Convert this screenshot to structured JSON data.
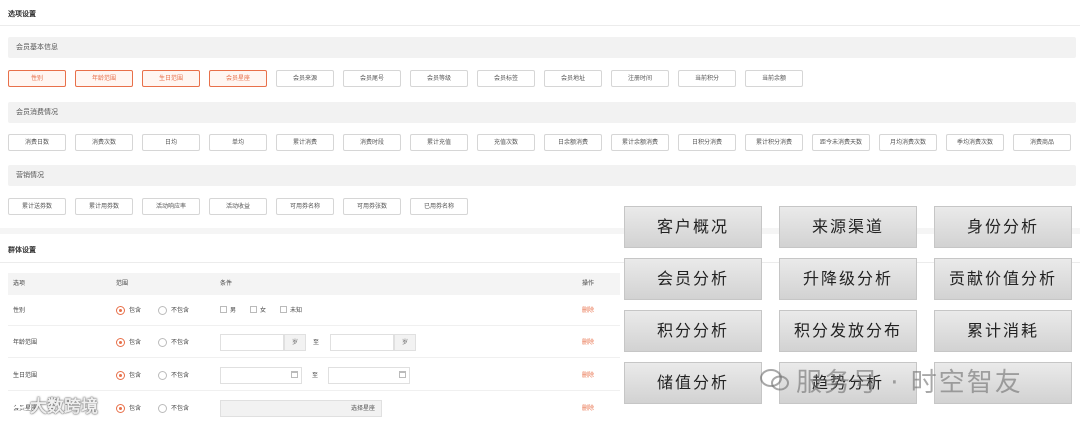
{
  "options": {
    "title": "选项设置",
    "groups": [
      {
        "label": "会员基本信息",
        "chips": [
          {
            "label": "性别",
            "active": true
          },
          {
            "label": "年龄范围",
            "active": true
          },
          {
            "label": "生日范围",
            "active": true
          },
          {
            "label": "会员星座",
            "active": true
          },
          {
            "label": "会员来源",
            "active": false
          },
          {
            "label": "会员尾号",
            "active": false
          },
          {
            "label": "会员等级",
            "active": false
          },
          {
            "label": "会员标签",
            "active": false
          },
          {
            "label": "会员地址",
            "active": false
          },
          {
            "label": "注册时间",
            "active": false
          },
          {
            "label": "当前积分",
            "active": false
          },
          {
            "label": "当前余额",
            "active": false
          }
        ]
      },
      {
        "label": "会员消费情况",
        "chips": [
          {
            "label": "消费日数",
            "active": false
          },
          {
            "label": "消费次数",
            "active": false
          },
          {
            "label": "日均",
            "active": false
          },
          {
            "label": "单均",
            "active": false
          },
          {
            "label": "累计消费",
            "active": false
          },
          {
            "label": "消费时段",
            "active": false
          },
          {
            "label": "累计充值",
            "active": false
          },
          {
            "label": "充值次数",
            "active": false
          },
          {
            "label": "日余额消费",
            "active": false
          },
          {
            "label": "累计余额消费",
            "active": false
          },
          {
            "label": "日积分消费",
            "active": false
          },
          {
            "label": "累计积分消费",
            "active": false
          },
          {
            "label": "距今未消费天数",
            "active": false
          },
          {
            "label": "月均消费次数",
            "active": false
          },
          {
            "label": "季均消费次数",
            "active": false
          },
          {
            "label": "消费商品",
            "active": false
          }
        ]
      },
      {
        "label": "营销情况",
        "chips": [
          {
            "label": "累计送券数",
            "active": false
          },
          {
            "label": "累计用券数",
            "active": false
          },
          {
            "label": "活动响应率",
            "active": false
          },
          {
            "label": "活动收益",
            "active": false
          },
          {
            "label": "可用券名称",
            "active": false
          },
          {
            "label": "可用券张数",
            "active": false
          },
          {
            "label": "已用券名称",
            "active": false
          }
        ]
      }
    ]
  },
  "group_settings": {
    "title": "群体设置",
    "headers": {
      "option": "选项",
      "range": "范围",
      "condition": "条件",
      "action": "操作"
    },
    "include_label": "包含",
    "exclude_label": "不包含",
    "delete_label": "删除",
    "rows": [
      {
        "option": "性别",
        "conditions": [
          "男",
          "女",
          "未知"
        ]
      },
      {
        "option": "年龄范围",
        "unit": "岁",
        "to_label": "至"
      },
      {
        "option": "生日范围",
        "to_label": "至"
      },
      {
        "option": "会员星座",
        "select_label": "选择星座"
      }
    ]
  },
  "feature_tiles": [
    "客户概况",
    "来源渠道",
    "身份分析",
    "会员分析",
    "升降级分析",
    "贡献价值分析",
    "积分分析",
    "积分发放分布",
    "累计消耗",
    "储值分析",
    "趋势分析",
    ""
  ],
  "watermark": {
    "text": "服务号 · 时空智友"
  },
  "logo": {
    "text": "大数跨境"
  },
  "colors": {
    "accent": "#e8704a",
    "tile_bg": "#dcdcdc",
    "group_bg": "#f2f2f2"
  }
}
